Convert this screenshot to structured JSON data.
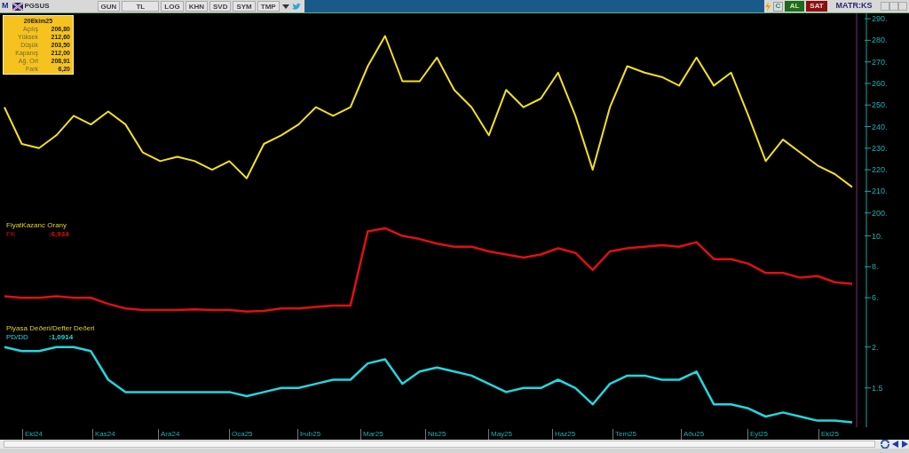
{
  "toolbar": {
    "symbol": "PGSUS",
    "buttons": [
      "GUN",
      "TL",
      "LOG",
      "KHN",
      "SVD",
      "SYM",
      "TMP"
    ],
    "logo_letter": "M",
    "c_button": "C",
    "buy": "AL",
    "sell": "SAT",
    "brand": "MATR:KS"
  },
  "info_box": {
    "date": "20Ekim25",
    "rows": [
      {
        "label": "Açılış",
        "value": "206,80"
      },
      {
        "label": "Yüksek",
        "value": "212,60"
      },
      {
        "label": "Düşük",
        "value": "203,50"
      },
      {
        "label": "Kapanış",
        "value": "212,00"
      },
      {
        "label": "Ağ. Ort",
        "value": "208,91"
      },
      {
        "label": "Fark",
        "value": "6,20"
      }
    ]
  },
  "panes": [
    {
      "chart_data": {
        "type": "line",
        "ylim": [
          197,
          292.5
        ],
        "yticks": [
          {
            "value": 200,
            "label": "200."
          },
          {
            "value": 210,
            "label": "210."
          },
          {
            "value": 220,
            "label": "220."
          },
          {
            "value": 230,
            "label": "230."
          },
          {
            "value": 240,
            "label": "240."
          },
          {
            "value": 250,
            "label": "250."
          },
          {
            "value": 260,
            "label": "260."
          },
          {
            "value": 270,
            "label": "270."
          },
          {
            "value": 280,
            "label": "280."
          },
          {
            "value": 290,
            "label": "290."
          }
        ],
        "series": [
          {
            "color": "#f5e11a",
            "values": [
              249,
              232,
              230,
              236,
              245,
              241,
              247,
              241,
              228,
              224,
              226,
              224,
              220,
              224,
              216,
              232,
              236,
              241,
              249,
              245,
              249,
              268,
              282,
              261,
              261,
              272,
              257,
              249,
              236,
              257,
              249,
              253,
              265,
              245,
              220,
              249,
              268,
              265,
              263,
              259,
              272,
              259,
              265,
              245,
              224,
              234,
              228,
              222,
              218,
              212
            ]
          }
        ]
      }
    },
    {
      "title": "FiyatKazanc Orany",
      "legend_value": ":6,934",
      "chart_data": {
        "type": "line",
        "ylim": [
          4.4,
          11.07
        ],
        "yticks": [
          {
            "value": 6,
            "label": "6."
          },
          {
            "value": 8,
            "label": "8."
          },
          {
            "value": 10,
            "label": "10."
          }
        ],
        "series": [
          {
            "name": "FK",
            "color": "#e01010",
            "values": [
              6.1,
              6.0,
              6.0,
              6.1,
              6.0,
              6.0,
              5.6,
              5.3,
              5.2,
              5.2,
              5.2,
              5.25,
              5.2,
              5.2,
              5.1,
              5.15,
              5.3,
              5.3,
              5.4,
              5.5,
              5.5,
              10.3,
              10.5,
              10.0,
              9.8,
              9.5,
              9.3,
              9.3,
              9.0,
              8.8,
              8.6,
              8.8,
              9.2,
              8.9,
              7.8,
              9.0,
              9.2,
              9.3,
              9.4,
              9.3,
              9.6,
              8.5,
              8.5,
              8.2,
              7.6,
              7.6,
              7.3,
              7.4,
              7.0,
              6.9
            ]
          }
        ]
      }
    },
    {
      "title": "Piyasa Deðeri/Defter Deðeri",
      "legend_value": ":1,0914",
      "chart_data": {
        "type": "line",
        "ylim": [
          1.02,
          2.3
        ],
        "yticks": [
          {
            "value": 1.5,
            "label": "1.5"
          },
          {
            "value": 2,
            "label": "2."
          }
        ],
        "series": [
          {
            "name": "PD/DD",
            "color": "#20d8e0",
            "values": [
              2.0,
              1.95,
              1.95,
              2.0,
              2.0,
              1.95,
              1.6,
              1.45,
              1.45,
              1.45,
              1.45,
              1.45,
              1.45,
              1.45,
              1.4,
              1.45,
              1.5,
              1.5,
              1.55,
              1.6,
              1.6,
              1.8,
              1.85,
              1.55,
              1.7,
              1.75,
              1.7,
              1.65,
              1.55,
              1.45,
              1.5,
              1.5,
              1.6,
              1.5,
              1.3,
              1.55,
              1.65,
              1.65,
              1.6,
              1.6,
              1.7,
              1.3,
              1.3,
              1.25,
              1.15,
              1.2,
              1.15,
              1.1,
              1.1,
              1.08
            ]
          }
        ]
      }
    }
  ],
  "time_axis": [
    "Eki24",
    "Kas24",
    "Ara24",
    "Oca25",
    "Þub25",
    "Mar25",
    "Nis25",
    "May25",
    "Haz25",
    "Tem25",
    "Aðu25",
    "Eyl25",
    "Eki25"
  ]
}
